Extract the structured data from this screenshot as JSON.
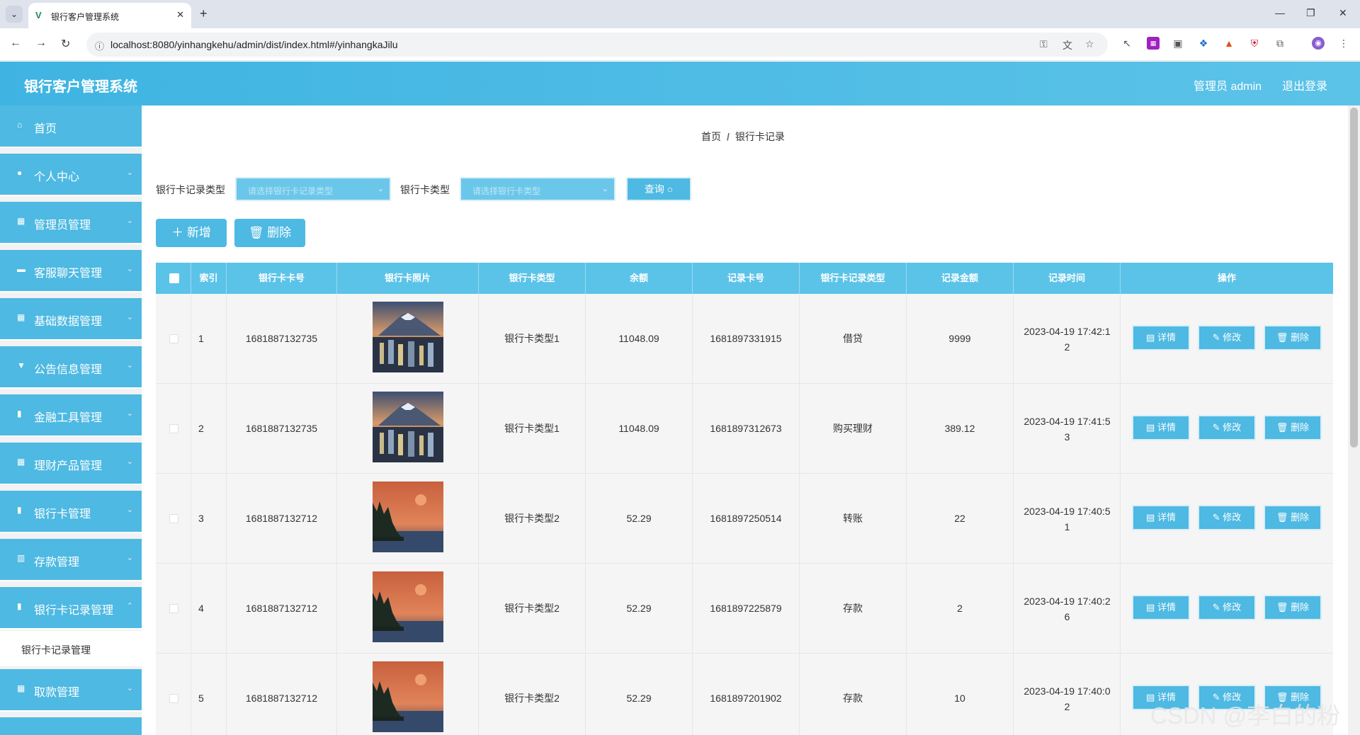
{
  "browser": {
    "tab_title": "银行客户管理系统",
    "url": "localhost:8080/yinhangkehu/admin/dist/index.html#/yinhangkaJilu"
  },
  "header": {
    "title": "银行客户管理系统",
    "user": "管理员 admin",
    "logout": "退出登录"
  },
  "sidebar": {
    "items": [
      {
        "label": "首页",
        "icon": "home-icon"
      },
      {
        "label": "个人中心",
        "icon": "user-icon"
      },
      {
        "label": "管理员管理",
        "icon": "grid-icon"
      },
      {
        "label": "客服聊天管理",
        "icon": "chat-icon"
      },
      {
        "label": "基础数据管理",
        "icon": "grid-icon"
      },
      {
        "label": "公告信息管理",
        "icon": "notice-icon"
      },
      {
        "label": "金融工具管理",
        "icon": "doc-icon"
      },
      {
        "label": "理财产品管理",
        "icon": "grid-icon"
      },
      {
        "label": "银行卡管理",
        "icon": "doc-icon"
      },
      {
        "label": "存款管理",
        "icon": "chart-icon"
      },
      {
        "label": "银行卡记录管理",
        "icon": "doc-icon"
      },
      {
        "label": "取款管理",
        "icon": "grid-icon"
      }
    ],
    "submenu": "银行卡记录管理"
  },
  "breadcrumb": {
    "home": "首页",
    "current": "银行卡记录"
  },
  "filters": {
    "record_type_label": "银行卡记录类型",
    "record_type_placeholder": "请选择银行卡记录类型",
    "card_type_label": "银行卡类型",
    "card_type_placeholder": "请选择银行卡类型",
    "query": "查询"
  },
  "actions": {
    "add": "新增",
    "delete": "删除"
  },
  "table": {
    "headers": [
      "索引",
      "银行卡卡号",
      "银行卡照片",
      "银行卡类型",
      "余额",
      "记录卡号",
      "银行卡记录类型",
      "记录金额",
      "记录时间",
      "操作"
    ],
    "op_labels": {
      "detail": "详情",
      "edit": "修改",
      "delete": "删除"
    },
    "rows": [
      {
        "index": "1",
        "card_no": "1681887132735",
        "photo": "mountain-city",
        "card_type": "银行卡类型1",
        "balance": "11048.09",
        "record_no": "1681897331915",
        "record_type": "借贷",
        "amount": "9999",
        "time_1": "2023-04-19 17:42:1",
        "time_2": "2"
      },
      {
        "index": "2",
        "card_no": "1681887132735",
        "photo": "mountain-city",
        "card_type": "银行卡类型1",
        "balance": "11048.09",
        "record_no": "1681897312673",
        "record_type": "购买理财",
        "amount": "389.12",
        "time_1": "2023-04-19 17:41:5",
        "time_2": "3"
      },
      {
        "index": "3",
        "card_no": "1681887132712",
        "photo": "sunset-lake",
        "card_type": "银行卡类型2",
        "balance": "52.29",
        "record_no": "1681897250514",
        "record_type": "转账",
        "amount": "22",
        "time_1": "2023-04-19 17:40:5",
        "time_2": "1"
      },
      {
        "index": "4",
        "card_no": "1681887132712",
        "photo": "sunset-lake",
        "card_type": "银行卡类型2",
        "balance": "52.29",
        "record_no": "1681897225879",
        "record_type": "存款",
        "amount": "2",
        "time_1": "2023-04-19 17:40:2",
        "time_2": "6"
      },
      {
        "index": "5",
        "card_no": "1681887132712",
        "photo": "sunset-lake",
        "card_type": "银行卡类型2",
        "balance": "52.29",
        "record_no": "1681897201902",
        "record_type": "存款",
        "amount": "10",
        "time_1": "2023-04-19 17:40:0",
        "time_2": "2"
      }
    ]
  },
  "watermark": "CSDN @李白的粉"
}
